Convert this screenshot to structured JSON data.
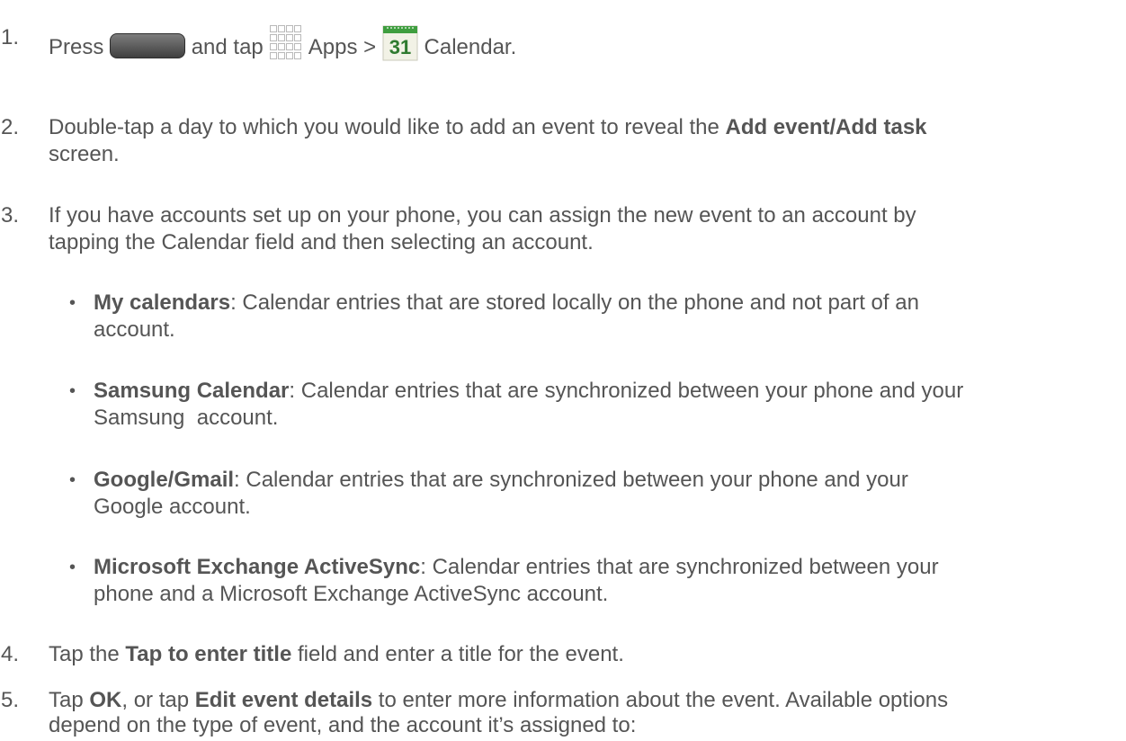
{
  "steps": [
    {
      "num": "1.",
      "segments": {
        "press": "Press",
        "and_tap": "and tap",
        "apps": "Apps >",
        "calendar_icon_text": "31",
        "calendar": "Calendar."
      }
    },
    {
      "num": "2.",
      "line1_pre": "Double-tap a day to which you would like to add an event to reveal the ",
      "line1_bold": "Add event/Add task",
      "line2": "screen."
    },
    {
      "num": "3.",
      "line1": "If you have accounts set up on your phone, you can assign the new event to an account by",
      "line2": "tapping the Calendar field and then selecting an account."
    },
    {
      "num": "4.",
      "pre": "Tap the ",
      "bold": "Tap to enter title",
      "post": " field and enter a title for the event."
    },
    {
      "num": "5.",
      "pre": "Tap ",
      "bold1": "OK",
      "mid": ", or tap ",
      "bold2": "Edit event details",
      "post": " to enter more information about the event. Available options",
      "line2": "depend on the type of event, and the account it’s assigned to:"
    }
  ],
  "bullets": [
    {
      "bold": "My calendars",
      "line1": ": Calendar entries that are stored locally on the phone and not part of an",
      "line2": "account."
    },
    {
      "bold": "Samsung Calendar",
      "line1": ": Calendar entries that are synchronized between your phone and your",
      "line2": "Samsung  account."
    },
    {
      "bold": "Google/Gmail",
      "line1": ": Calendar entries that are synchronized between your phone and your",
      "line2": "Google account."
    },
    {
      "bold": "Microsoft Exchange ActiveSync",
      "line1": ": Calendar entries that are synchronized between your",
      "line2": "phone and a Microsoft Exchange ActiveSync account."
    }
  ],
  "icons": {
    "home_key": "home-key-icon",
    "apps": "apps-grid-icon",
    "calendar": "calendar-icon"
  },
  "colors": {
    "text": "#555555",
    "calendar_green": "#2e8b2e",
    "calendar_number": "#2f7a2f"
  }
}
